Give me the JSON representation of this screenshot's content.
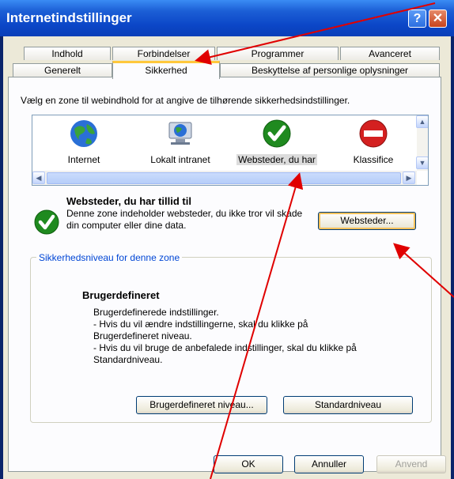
{
  "window": {
    "title": "Internetindstillinger",
    "help_glyph": "?",
    "close_glyph": "✕"
  },
  "tabs_row1": [
    {
      "label": "Indhold"
    },
    {
      "label": "Forbindelser"
    },
    {
      "label": "Programmer"
    },
    {
      "label": "Avanceret"
    }
  ],
  "tabs_row2": [
    {
      "label": "Generelt"
    },
    {
      "label": "Sikkerhed"
    },
    {
      "label": "Beskyttelse af personlige oplysninger"
    }
  ],
  "security": {
    "instruction": "Vælg en zone til webindhold for at angive de tilhørende sikkerhedsindstillinger.",
    "zones": [
      {
        "label": "Internet",
        "icon": "globe-icon"
      },
      {
        "label": "Lokalt intranet",
        "icon": "intranet-icon"
      },
      {
        "label": "Websteder, du har",
        "icon": "trusted-check-icon",
        "selected": true
      },
      {
        "label": "Klassifice",
        "icon": "restricted-icon"
      }
    ],
    "selected_zone": {
      "title": "Websteder, du har tillid til",
      "description": "Denne zone indeholder websteder, du ikke tror vil skade din computer eller dine data.",
      "sites_button": "Websteder..."
    },
    "level_group": {
      "legend": "Sikkerhedsniveau for denne zone",
      "level_name": "Brugerdefineret",
      "lines": [
        "Brugerdefinerede indstillinger.",
        " - Hvis du vil ændre indstillingerne, skal du klikke på",
        "Brugerdefineret niveau.",
        " - Hvis du vil bruge de anbefalede indstillinger, skal du klikke på",
        "Standardniveau."
      ],
      "custom_button": "Brugerdefineret niveau...",
      "default_button": "Standardniveau"
    }
  },
  "footer": {
    "ok": "OK",
    "cancel": "Annuller",
    "apply": "Anvend"
  },
  "colors": {
    "titlebar": "#0b46c7",
    "dialog_bg": "#ece9d8",
    "annotation_arrow": "#e00000",
    "active_tab_accent": "#ffc83c"
  }
}
